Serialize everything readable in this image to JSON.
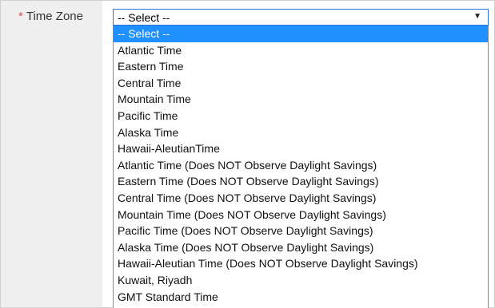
{
  "field": {
    "required_marker": "*",
    "label": "Time Zone"
  },
  "select": {
    "value": "-- Select --",
    "caret": "▼"
  },
  "options": [
    "-- Select --",
    "Atlantic Time",
    "Eastern Time",
    "Central Time",
    "Mountain Time",
    "Pacific Time",
    "Alaska Time",
    "Hawaii-AleutianTime",
    "Atlantic Time (Does NOT Observe Daylight Savings)",
    "Eastern Time (Does NOT Observe Daylight Savings)",
    "Central Time (Does NOT Observe Daylight Savings)",
    "Mountain Time (Does NOT Observe Daylight Savings)",
    "Pacific Time (Does NOT Observe Daylight Savings)",
    "Alaska Time (Does NOT Observe Daylight Savings)",
    "Hawaii-Aleutian Time (Does NOT Observe Daylight Savings)",
    "Kuwait, Riyadh",
    "GMT Standard Time"
  ],
  "highlighted_index": 0,
  "colors": {
    "highlight": "#1e90ff",
    "required": "#d9534f",
    "focus_border": "#2a6fdb"
  }
}
